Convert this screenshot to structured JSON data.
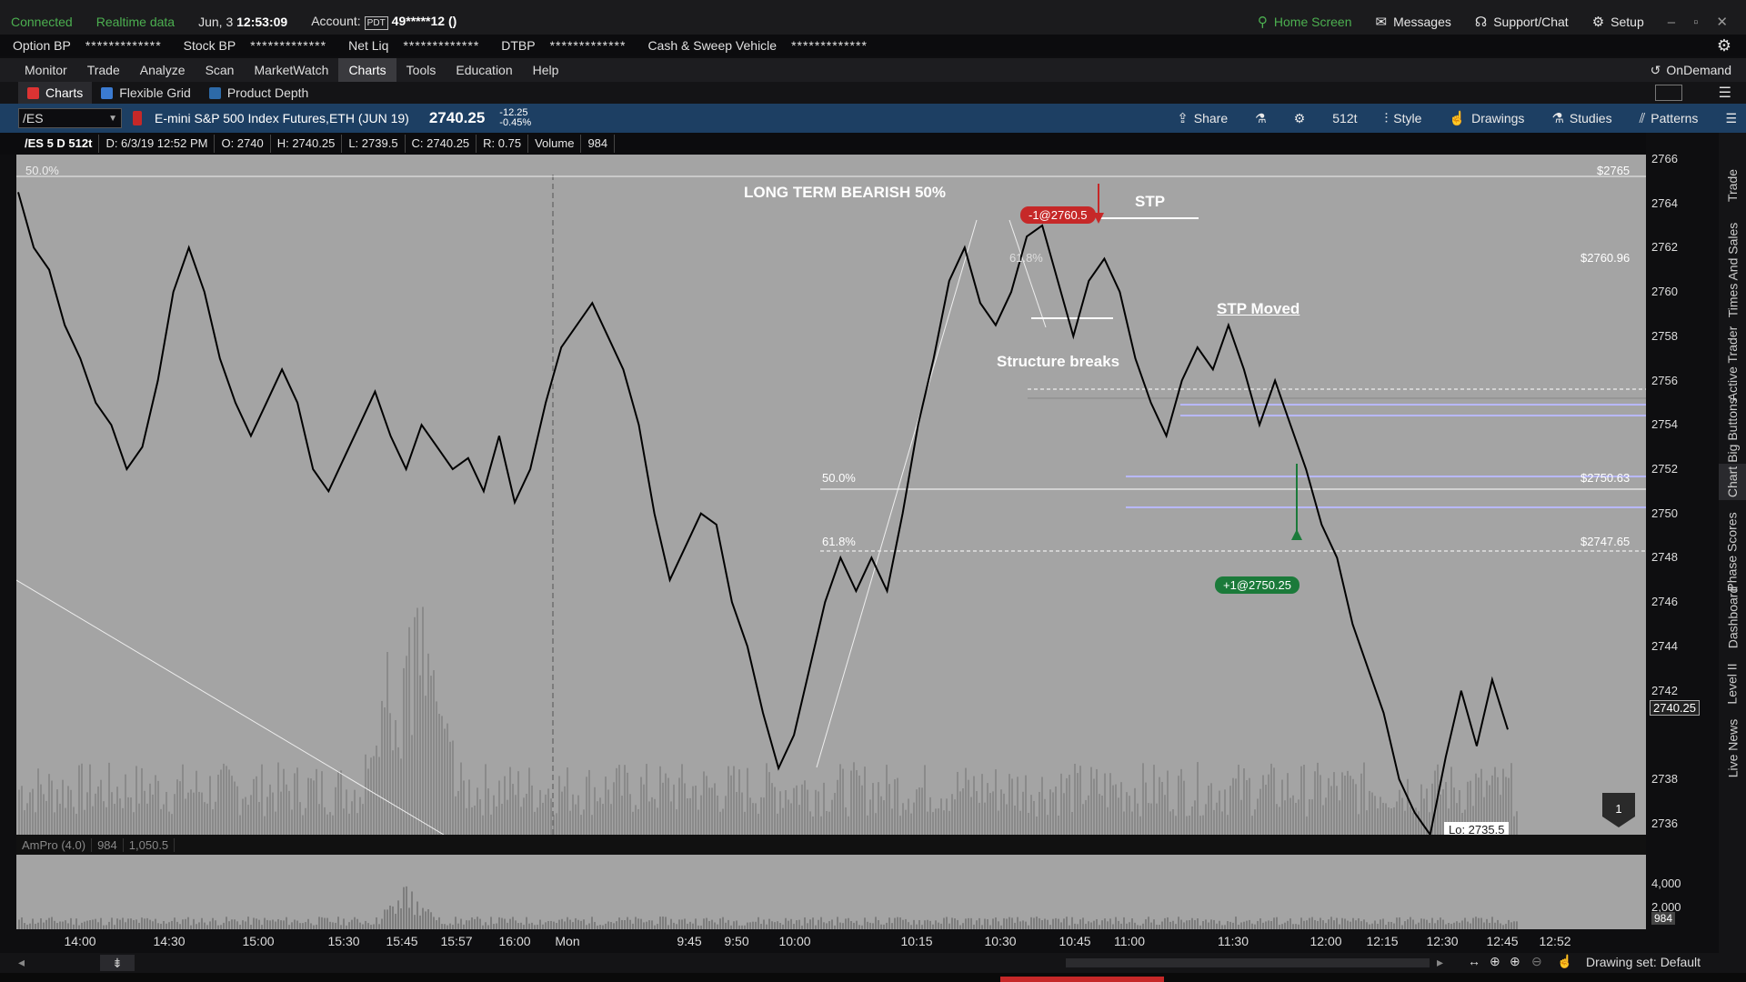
{
  "status": {
    "connected": "Connected",
    "realtime": "Realtime data",
    "date": "Jun, 3",
    "time": "12:53:09",
    "account_label": "Account:",
    "pdt": "PDT",
    "account_number": "49*****12 ()",
    "home": "Home Screen",
    "messages": "Messages",
    "support": "Support/Chat",
    "setup": "Setup"
  },
  "bp": {
    "option_bp": "Option BP",
    "option_val": "*************",
    "stock_bp": "Stock BP",
    "stock_val": "*************",
    "netliq": "Net Liq",
    "netliq_val": "*************",
    "dtbp": "DTBP",
    "dtbp_val": "*************",
    "sweep": "Cash & Sweep Vehicle",
    "sweep_val": "*************"
  },
  "menu": [
    "Monitor",
    "Trade",
    "Analyze",
    "Scan",
    "MarketWatch",
    "Charts",
    "Tools",
    "Education",
    "Help"
  ],
  "ondemand": "OnDemand",
  "tabs": [
    "Charts",
    "Flexible Grid",
    "Product Depth"
  ],
  "symbar": {
    "symbol": "/ES",
    "description": "E-mini S&P 500 Index Futures,ETH (JUN 19)",
    "price": "2740.25",
    "change": "-12.25",
    "change_pct": "-0.45%",
    "share": "Share",
    "ticks": "512t",
    "style": "Style",
    "drawings": "Drawings",
    "studies": "Studies",
    "patterns": "Patterns"
  },
  "ohlc": {
    "label": "/ES 5 D 512t",
    "d": "D: 6/3/19 12:52 PM",
    "o": "O: 2740",
    "h": "H: 2740.25",
    "l": "L: 2739.5",
    "c": "C: 2740.25",
    "r": "R: 0.75",
    "volume_label": "Volume",
    "volume": "984"
  },
  "annotations": {
    "long_term": "LONG TERM BEARISH 50%",
    "stp": "STP",
    "stp_moved": "STP Moved",
    "structure": "Structure breaks",
    "sell_order": "-1@2760.5",
    "buy_order": "+1@2750.25",
    "fib_top": "50.0%",
    "fib_618_top": "61.8%",
    "fib_50": "50.0%",
    "fib_618": "61.8%",
    "price_2765": "$2765",
    "price_2760": "$2760.96",
    "price_2750": "$2750.63",
    "price_2747": "$2747.65",
    "low": "Lo: 2735.5",
    "marker": "1"
  },
  "volume_pane": {
    "name": "AmPro (4.0)",
    "v1": "984",
    "v2": "1,050.5",
    "y1": "4,000",
    "y2": "2,000",
    "y3": "984"
  },
  "yaxis": [
    "2766",
    "2764",
    "2762",
    "2760",
    "2758",
    "2756",
    "2754",
    "2752",
    "2750",
    "2748",
    "2746",
    "2744",
    "2742",
    "2740.25",
    "2738",
    "2736"
  ],
  "xaxis": [
    "14:00",
    "14:30",
    "15:00",
    "15:30",
    "15:45",
    "15:57",
    "16:00",
    "Mon",
    "9:45",
    "9:50",
    "10:00",
    "10:15",
    "10:30",
    "10:45",
    "11:00",
    "11:30",
    "12:00",
    "12:15",
    "12:30",
    "12:45",
    "12:52"
  ],
  "side_tabs": [
    "Trade",
    "Times And Sales",
    "Active Trader",
    "Big Buttons",
    "Chart",
    "Phase Scores",
    "Dashboard",
    "Level II",
    "Live News"
  ],
  "drawing_set": "Drawing set: Default",
  "colors": {
    "up": "#4caf50",
    "sell": "#c62828",
    "buy": "#1b7a3a",
    "symbar": "#1d3f63",
    "chart_bg": "#a4a4a4"
  },
  "chart_data": {
    "type": "line",
    "title": "",
    "series": [
      {
        "values": [
          2764.5,
          2762,
          2761,
          2758.5,
          2757,
          2755,
          2754,
          2752,
          2753,
          2756,
          2760,
          2762,
          2760,
          2757,
          2755,
          2753.5,
          2755,
          2756.5,
          2755,
          2752,
          2751,
          2752.5,
          2754,
          2755.5,
          2753.5,
          2752,
          2754,
          2753,
          2752,
          2752.5,
          2751,
          2753.5,
          2750.5,
          2752,
          2755,
          2757.5,
          2758.5,
          2759.5,
          2758,
          2756.5,
          2754,
          2750,
          2747,
          2748.5,
          2750,
          2749.5,
          2746,
          2744,
          2741,
          2738.5,
          2740,
          2743,
          2746,
          2748,
          2746.5,
          2748,
          2746.5,
          2750,
          2754,
          2757,
          2760.5,
          2762,
          2759.5,
          2758.5,
          2760,
          2762.5,
          2763,
          2760.5,
          2758,
          2760.5,
          2761.5,
          2760,
          2757,
          2755,
          2753.5,
          2756,
          2757.5,
          2756.5,
          2758.5,
          2756.5,
          2754,
          2756,
          2754,
          2752,
          2749.5,
          2748,
          2745,
          2743,
          2741,
          2738,
          2736.5,
          2735.5,
          2739,
          2742,
          2739.5,
          2742.5,
          2740.25
        ],
        "range_high": 2764.75,
        "range_low": 2735.5
      }
    ],
    "ylim": [
      2735.5,
      2766.2
    ],
    "xlabels": [
      "14:00",
      "14:30",
      "15:00",
      "15:30",
      "15:45",
      "15:57",
      "16:00",
      "Mon",
      "9:45",
      "9:50",
      "10:00",
      "10:15",
      "10:30",
      "10:45",
      "11:00",
      "11:30",
      "12:00",
      "12:15",
      "12:30",
      "12:45",
      "12:52"
    ],
    "levels": [
      2765,
      2760.96,
      2750.63,
      2747.65
    ]
  }
}
